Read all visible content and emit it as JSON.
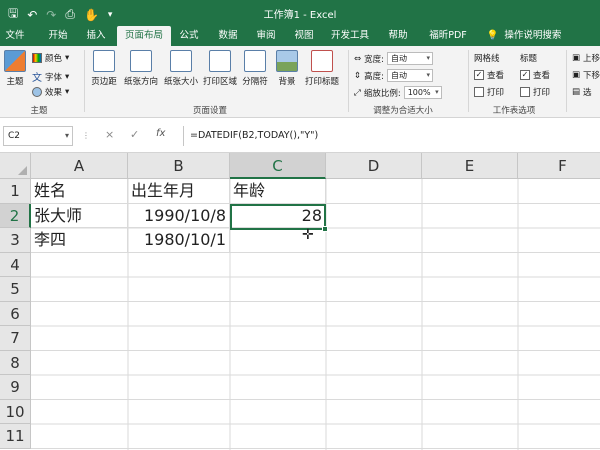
{
  "window": {
    "title": "工作簿1  -  Excel",
    "qat_icons": [
      "save-icon",
      "undo-icon",
      "redo-icon",
      "print-preview-icon",
      "touch-mode-icon",
      "customize-qat-icon"
    ]
  },
  "tabs": [
    {
      "label": "文件"
    },
    {
      "label": "开始"
    },
    {
      "label": "插入"
    },
    {
      "label": "页面布局",
      "active": true
    },
    {
      "label": "公式"
    },
    {
      "label": "数据"
    },
    {
      "label": "审阅"
    },
    {
      "label": "视图"
    },
    {
      "label": "开发工具"
    },
    {
      "label": "帮助"
    },
    {
      "label": "福昕PDF"
    },
    {
      "label": "操作说明搜索"
    }
  ],
  "ribbon": {
    "theme_group": {
      "label": "主题",
      "theme_button": "主题",
      "colors": "颜色",
      "fonts": "字体",
      "effects": "效果"
    },
    "page_setup_group": {
      "label": "页面设置",
      "buttons": [
        "页边距",
        "纸张方向",
        "纸张大小",
        "打印区域",
        "分隔符",
        "背景",
        "打印标题"
      ]
    },
    "scale_group": {
      "label": "调整为合适大小",
      "width_label": "宽度:",
      "width_value": "自动",
      "height_label": "高度:",
      "height_value": "自动",
      "scale_label": "缩放比例:",
      "scale_value": "100%"
    },
    "sheet_options_group": {
      "label": "工作表选项",
      "gridlines": "网格线",
      "headings": "标题",
      "view": "查看",
      "print": "打印"
    },
    "arrange_group": {
      "up": "上移",
      "down": "下移",
      "select": "选"
    }
  },
  "formula_bar": {
    "name_box": "C2",
    "cancel": "×",
    "enter": "✓",
    "fx": "fx",
    "formula": "=DATEDIF(B2,TODAY(),\"Y\")"
  },
  "sheet": {
    "columns": [
      "A",
      "B",
      "C",
      "D",
      "E",
      "F"
    ],
    "rows": [
      "1",
      "2",
      "3",
      "4",
      "5",
      "6",
      "7",
      "8",
      "9",
      "10",
      "11"
    ],
    "cells": {
      "A1": "姓名",
      "B1": "出生年月",
      "C1": "年龄",
      "A2": "张大师",
      "B2": "1990/10/8",
      "C2": "28",
      "A3": "李四",
      "B3": "1980/10/1"
    },
    "active_cell": "C2"
  },
  "colors": {
    "accent": "#217346",
    "header_bg": "#e6e6e6"
  }
}
